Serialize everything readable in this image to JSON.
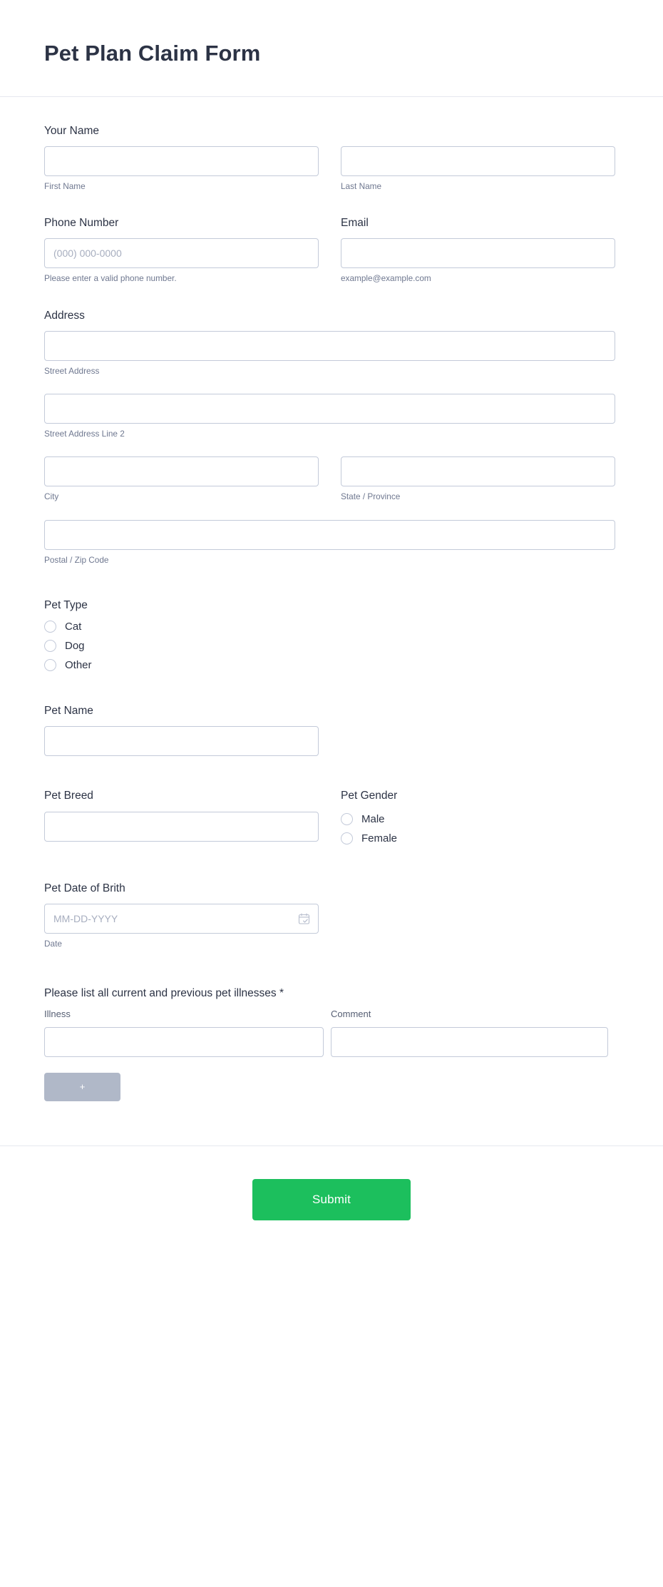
{
  "header": {
    "title": "Pet Plan Claim Form"
  },
  "fields": {
    "your_name": {
      "label": "Your Name",
      "first": {
        "sub_label": "First Name",
        "value": "",
        "placeholder": ""
      },
      "last": {
        "sub_label": "Last Name",
        "value": "",
        "placeholder": ""
      }
    },
    "phone": {
      "label": "Phone Number",
      "placeholder": "(000) 000-0000",
      "value": "",
      "sub_label": "Please enter a valid phone number."
    },
    "email": {
      "label": "Email",
      "placeholder": "",
      "value": "",
      "sub_label": "example@example.com"
    },
    "address": {
      "label": "Address",
      "street": {
        "sub_label": "Street Address",
        "value": ""
      },
      "street2": {
        "sub_label": "Street Address Line 2",
        "value": ""
      },
      "city": {
        "sub_label": "City",
        "value": ""
      },
      "state": {
        "sub_label": "State / Province",
        "value": ""
      },
      "postal": {
        "sub_label": "Postal / Zip Code",
        "value": ""
      }
    },
    "pet_type": {
      "label": "Pet Type",
      "options": [
        "Cat",
        "Dog",
        "Other"
      ],
      "selected": ""
    },
    "pet_name": {
      "label": "Pet Name",
      "value": "",
      "placeholder": ""
    },
    "pet_breed": {
      "label": "Pet Breed",
      "value": "",
      "placeholder": ""
    },
    "pet_gender": {
      "label": "Pet Gender",
      "options": [
        "Male",
        "Female"
      ],
      "selected": ""
    },
    "pet_dob": {
      "label": "Pet Date of Brith",
      "placeholder": "MM-DD-YYYY",
      "value": "",
      "sub_label": "Date",
      "icon": "calendar-icon"
    },
    "illnesses": {
      "label": "Please list all current and previous pet illnesses",
      "required_marker": "*",
      "columns": [
        "Illness",
        "Comment"
      ],
      "rows": [
        {
          "illness": "",
          "comment": ""
        }
      ],
      "add_button_label": "+"
    }
  },
  "footer": {
    "submit_label": "Submit"
  },
  "colors": {
    "submit_green": "#1cbf5d",
    "add_button_gray": "#b0b8c8",
    "input_border": "#c3cad9",
    "title_text": "#2c3345",
    "sub_label_text": "#6f7890"
  }
}
